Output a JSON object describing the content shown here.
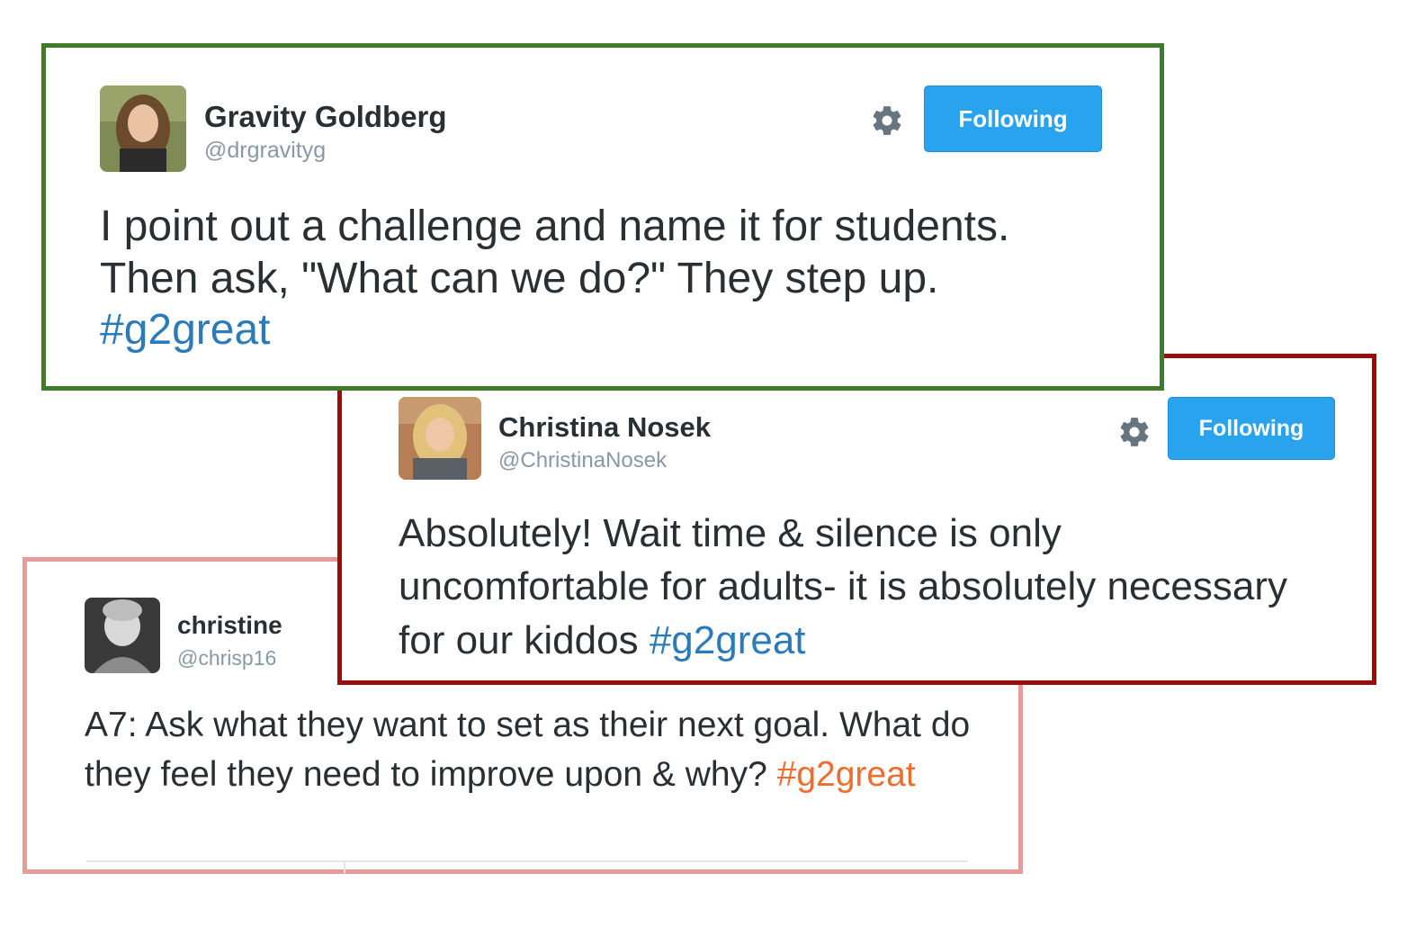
{
  "tweets": [
    {
      "name": "Gravity Goldberg",
      "handle": "@drgravityg",
      "text": "I point out a challenge and name it for students. Then ask, \"What can we do?\" They step up.",
      "hashtag": "#g2great",
      "follow_label": "Following",
      "border_color": "#3f7b28"
    },
    {
      "name": "Christina Nosek",
      "handle": "@ChristinaNosek",
      "text": "Absolutely! Wait time & silence is only uncomfortable for adults- it is absolutely necessary for our kiddos",
      "hashtag": "#g2great",
      "follow_label": "Following",
      "border_color": "#9b0d0d"
    },
    {
      "name": "christine",
      "handle": "@chrisp16",
      "text": "A7: Ask what they want to set as their next goal. What do they feel they need to improve upon & why?",
      "hashtag": "#g2great",
      "border_color": "#e79b9b"
    }
  ],
  "colors": {
    "follow_button": "#2aa3ef",
    "hashtag_blue": "#2b7bb9",
    "hashtag_orange": "#ef6c2f",
    "handle": "#8899a6"
  },
  "icons": {
    "settings": "gear-icon"
  }
}
